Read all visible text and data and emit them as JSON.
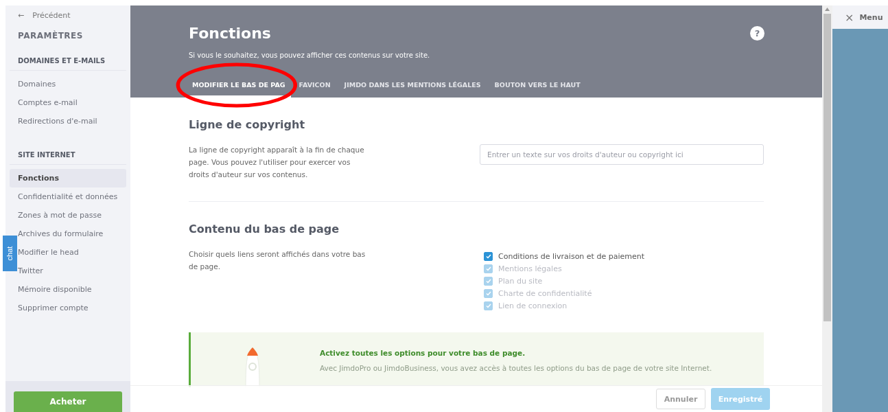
{
  "sidebar": {
    "back": {
      "arrow": "←",
      "label": "Précédent"
    },
    "title": "PARAMÈTRES",
    "sections": [
      {
        "heading": "DOMAINES ET E-MAILS",
        "items": [
          {
            "label": "Domaines",
            "selected": false
          },
          {
            "label": "Comptes e-mail",
            "selected": false
          },
          {
            "label": "Redirections d'e-mail",
            "selected": false
          }
        ]
      },
      {
        "heading": "SITE INTERNET",
        "items": [
          {
            "label": "Fonctions",
            "selected": true
          },
          {
            "label": "Confidentialité et données",
            "selected": false
          },
          {
            "label": "Zones à mot de passe",
            "selected": false
          },
          {
            "label": "Archives du formulaire",
            "selected": false
          },
          {
            "label": "Modifier le head",
            "selected": false
          },
          {
            "label": "Twitter",
            "selected": false
          },
          {
            "label": "Mémoire disponible",
            "selected": false
          },
          {
            "label": "Supprimer compte",
            "selected": false
          }
        ]
      }
    ],
    "buy_button": "Acheter"
  },
  "chat_tab": "chat",
  "header": {
    "title": "Fonctions",
    "subtitle": "Si vous le souhaitez, vous pouvez afficher ces contenus sur votre site.",
    "help": "?",
    "tabs": [
      {
        "label": "MODIFIER LE BAS DE PAG",
        "selected": true
      },
      {
        "label": "FAVICON",
        "selected": false
      },
      {
        "label": "JIMDO DANS LES MENTIONS LÉGALES",
        "selected": false
      },
      {
        "label": "BOUTON VERS LE HAUT",
        "selected": false
      }
    ]
  },
  "copyright": {
    "heading": "Ligne de copyright",
    "description": "La ligne de copyright apparaît à la fin de chaque page. Vous pouvez l'utiliser pour exercer vos droits d'auteur sur vos contenus.",
    "placeholder": "Entrer un texte sur vos droits d'auteur ou copyright ici"
  },
  "footer_content": {
    "heading": "Contenu du bas de page",
    "description": "Choisir quels liens seront affichés dans votre bas de page.",
    "options": [
      {
        "label": "Conditions de livraison et de paiement",
        "checked": true,
        "disabled": false
      },
      {
        "label": "Mentions légales",
        "checked": true,
        "disabled": true
      },
      {
        "label": "Plan du site",
        "checked": true,
        "disabled": true
      },
      {
        "label": "Charte de confidentialité",
        "checked": true,
        "disabled": true
      },
      {
        "label": "Lien de connexion",
        "checked": true,
        "disabled": true
      }
    ]
  },
  "promo": {
    "title": "Activez toutes les options pour votre bas de page.",
    "text": "Avec JimdoPro ou JimdoBusiness, vous avez accès à toutes les options du bas de page de votre site Internet."
  },
  "actions": {
    "cancel": "Annuler",
    "save": "Enregistré"
  },
  "right_panel": {
    "close": "×",
    "label": "Menu"
  }
}
